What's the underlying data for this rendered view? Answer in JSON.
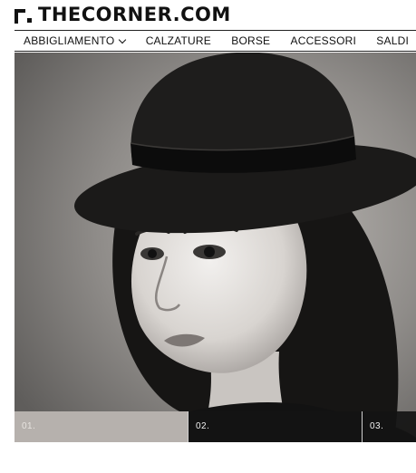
{
  "brand": {
    "logo_text": "THECORNER.COM"
  },
  "nav": {
    "items": [
      {
        "label": "ABBIGLIAMENTO",
        "has_dropdown": true
      },
      {
        "label": "CALZATURE"
      },
      {
        "label": "BORSE"
      },
      {
        "label": "ACCESSORI"
      },
      {
        "label": "SALDI"
      }
    ]
  },
  "hero": {
    "slides": [
      {
        "label": "01.",
        "active": true
      },
      {
        "label": "02.",
        "active": false
      },
      {
        "label": "03.",
        "active": false
      }
    ]
  }
}
